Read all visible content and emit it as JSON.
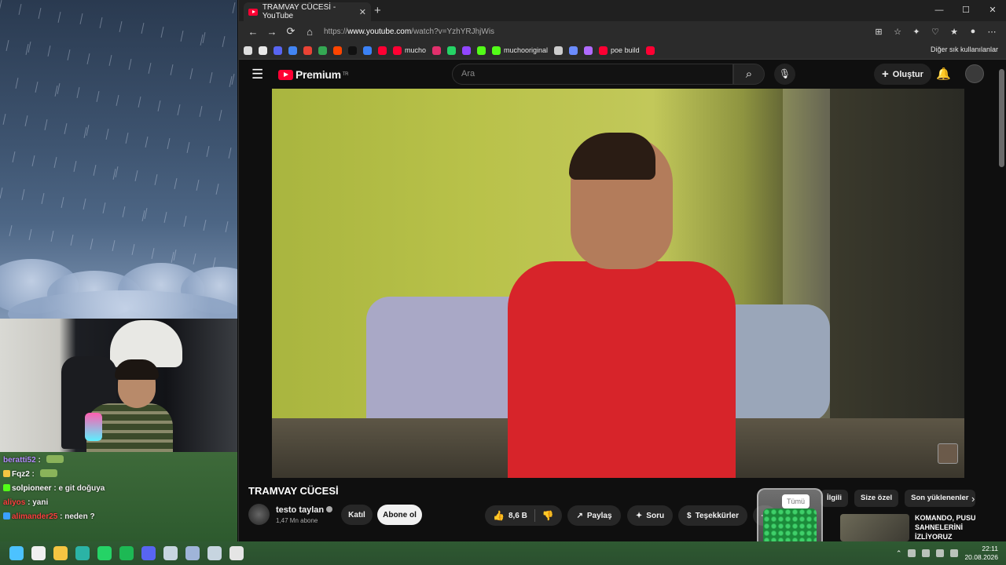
{
  "browser": {
    "tab_title": "TRAMVAY CÜCESİ - YouTube",
    "tab_close": "✕",
    "new_tab": "+",
    "window_controls": [
      "—",
      "☐",
      "✕"
    ],
    "url_prefix": "https://",
    "url_domain": "www.youtube.com",
    "url_path": "/watch?v=YzhYRJhjWis",
    "nav": [
      "←",
      "→",
      "⟳",
      "⌂"
    ],
    "bookmarks": [
      {
        "label": "",
        "color": "#dddddd"
      },
      {
        "label": "",
        "color": "#e8e8e8"
      },
      {
        "label": "",
        "color": "#5865f2"
      },
      {
        "label": "",
        "color": "#4285f4"
      },
      {
        "label": "",
        "color": "#ea4335"
      },
      {
        "label": "",
        "color": "#34a853"
      },
      {
        "label": "",
        "color": "#ff4500"
      },
      {
        "label": "",
        "color": "#111111"
      },
      {
        "label": "",
        "color": "#3b82f6"
      },
      {
        "label": "",
        "color": "#ff0033"
      },
      {
        "label": "mucho",
        "color": "#ff0033"
      },
      {
        "label": "",
        "color": "#e1306c"
      },
      {
        "label": "",
        "color": "#25d366"
      },
      {
        "label": "",
        "color": "#9146ff"
      },
      {
        "label": "",
        "color": "#53fc18"
      },
      {
        "label": "muchooriginal",
        "color": "#53fc18"
      },
      {
        "label": "",
        "color": "#cccccc"
      },
      {
        "label": "",
        "color": "#6b8cff"
      },
      {
        "label": "",
        "color": "#b06bff"
      },
      {
        "label": "poe build",
        "color": "#ff0033"
      },
      {
        "label": "",
        "color": "#ff0033"
      }
    ],
    "other_bookmarks": "Diğer sık kullanılanlar"
  },
  "youtube": {
    "logo_text": "Premium",
    "logo_region": "TR",
    "search_placeholder": "Ara",
    "create_label": "Oluştur",
    "video_title": "TRAMVAY CÜCESİ",
    "channel_name": "testo taylan",
    "subscribers": "1,47 Mn abone",
    "join_label": "Katıl",
    "subscribe_label": "Abone ol",
    "likes": "8,6 B",
    "share_label": "Paylaş",
    "ask_label": "Soru",
    "thanks_label": "Teşekkürler",
    "chips": [
      "İlgili",
      "Size özel",
      "Son yüklenenler"
    ],
    "jar_label": "Tümü",
    "recommended_title": "KOMANDO, PUSU SAHNELERİNİ İZLİYORUZ"
  },
  "chat": [
    {
      "user": "beratti52",
      "user_color": "#b48cff",
      "msg": "",
      "badge_color": "",
      "emote": true
    },
    {
      "user": "Fqz2",
      "user_color": "#ffffff",
      "msg": "",
      "badge_color": "#f5c542",
      "emote": true
    },
    {
      "user": "solpioneer",
      "user_color": "#ffffff",
      "msg": "e git doğuya",
      "badge_color": "#53fc18",
      "emote": false
    },
    {
      "user": "aliyos",
      "user_color": "#ff4040",
      "msg": "yani",
      "badge_color": "",
      "emote": false
    },
    {
      "user": "alimander25",
      "user_color": "#ff4040",
      "msg": "neden ?",
      "badge_color": "#3aa0ff",
      "emote": false
    }
  ],
  "taskbar": {
    "time": "22:11",
    "date": "20.08.2026",
    "apps": [
      {
        "name": "windows",
        "color": "#4cc2ff"
      },
      {
        "name": "widgets",
        "color": "#f0f0f0"
      },
      {
        "name": "explorer",
        "color": "#f5c542"
      },
      {
        "name": "edge",
        "color": "#2bb3a6"
      },
      {
        "name": "whatsapp",
        "color": "#25d366"
      },
      {
        "name": "spotify",
        "color": "#1db954"
      },
      {
        "name": "discord",
        "color": "#5865f2"
      },
      {
        "name": "steam",
        "color": "#c7d5e0"
      },
      {
        "name": "app",
        "color": "#9fb4d9"
      },
      {
        "name": "steam2",
        "color": "#c7d5e0"
      },
      {
        "name": "obs",
        "color": "#e5e5e5"
      }
    ]
  }
}
